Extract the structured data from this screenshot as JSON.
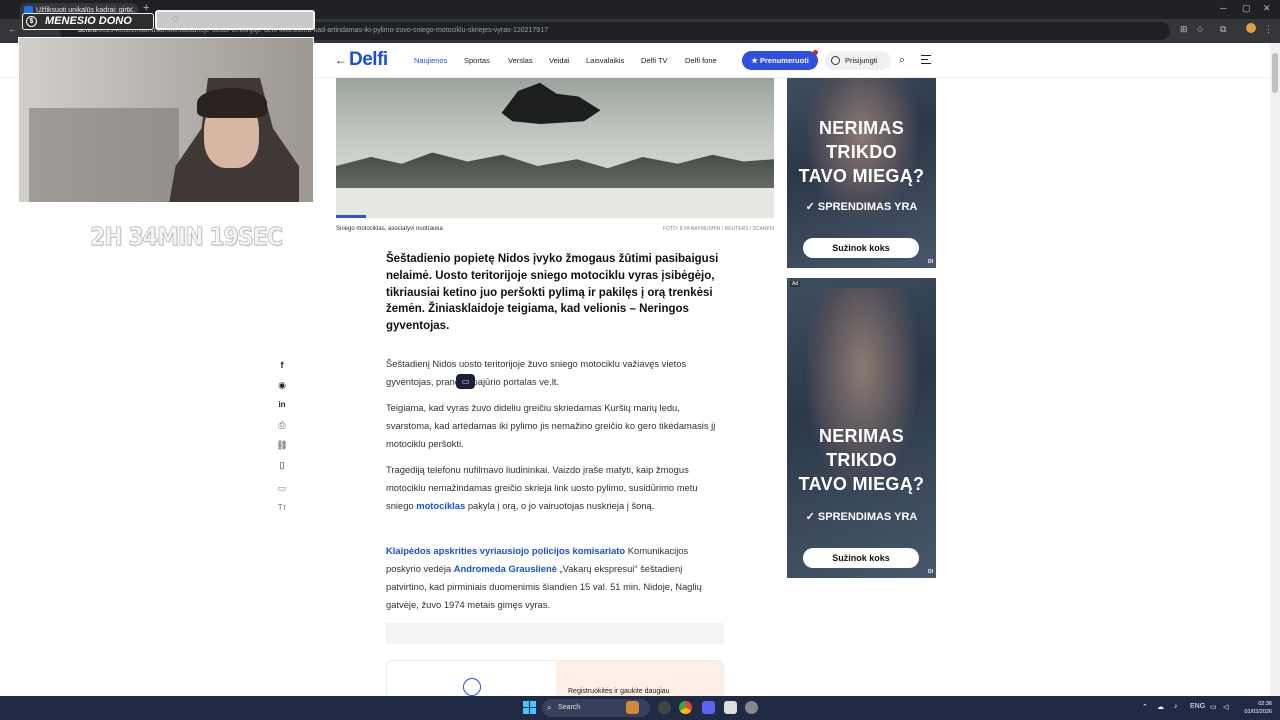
{
  "browser": {
    "tab_title": "Užfiksuoti unikalūs kadrai: girt…",
    "url_domain": "delfi.lt",
    "url_path": "/80294692/ziniamusamolt/siaudineje-uosto-teritorijoje-delfi-svarstoma-kad-artindamas-iki-pylimo-zuvo-sniego-motociklu-skriejes-vyras-120217917",
    "new_tab": "+",
    "close": "✕"
  },
  "overlay": {
    "donor_label": "MENESIO DONO",
    "timer": "2H 34MIN 19SEC"
  },
  "site": {
    "logo": "Delfi",
    "nav": [
      "Naujienos",
      "Sportas",
      "Verslas",
      "Veidai",
      "Laisvalaikis",
      "Delfi TV",
      "Delfi fone"
    ],
    "subscribe": "Prenumeruoti",
    "login": "Prisijungti"
  },
  "article": {
    "caption": "Sniego motociklas, asociatyvi nuotrauka",
    "credit": "FOTO: ILYA NAYMUSHIN / REUTERS / SCANPIX",
    "lead": "Šeštadienio popietę Nidos įvyko žmogaus žūtimi pasibaigusi nelaimė. Uosto teritorijoje sniego motociklu vyras įsibėgėjo, tikriausiai ketino juo peršokti pylimą ir pakilęs į orą trenkėsi žemėn. Žiniasklaidoje teigiama, kad velionis – Neringos gyventojas.",
    "p1": "Šeštadienį Nidos uosto teritorijoje žuvo sniego motociklu važiavęs vietos gyventojas, praneša pajūrio portalas ve.lt.",
    "p2": "Teigiama, kad vyras žuvo dideliu greičiu skriedamas Kuršių marių ledu, svarstoma, kad artėdamas iki pylimo jis nemažino greičio ko gero tikėdamasis jį motociklu peršokti.",
    "p3_a": "Tragediją telefonu nufilmavo liudininkai. Vaizdo įraše matyti, kaip žmogus motociklu nemažindamas greičio skrieja link uosto pylimo, susidūrimo metu sniego ",
    "p3_link": "motociklas",
    "p3_b": " pakyla į orą, o jo vairuotojas nuskrieja į šoną.",
    "p4_link1": "Klaipėdos apskrities vyriausiojo policijos komisariato",
    "p4_a": " Komunikacijos poskyrio vedėja ",
    "p4_link2": "Andromeda Grauslienė",
    "p4_b": " „Vakarų ekspresui“ šeštadienį patvirtino, kad pirminiais duomenimis šiandien 15 val. 51 min. Nidoje, Naglių gatvėje, žuvo 1974 metais gimęs vyras.",
    "promo_text": "Registruokitės ir gaukite daugiau"
  },
  "ads": [
    {
      "headline": [
        "NERIMAS",
        "TRIKDO",
        "TAVO MIEGĄ?"
      ],
      "solution": "SPRENDIMAS YRA",
      "button": "Sužinok koks",
      "badge": "DI"
    },
    {
      "headline": [
        "NERIMAS",
        "TRIKDO",
        "TAVO MIEGĄ?"
      ],
      "solution": "SPRENDIMAS YRA",
      "button": "Sužinok koks",
      "badge": "DI",
      "ad_label": "Ad"
    }
  ],
  "taskbar": {
    "search": "Search",
    "lang": "ENG",
    "time": "02:36",
    "date": "01/03/2026"
  }
}
